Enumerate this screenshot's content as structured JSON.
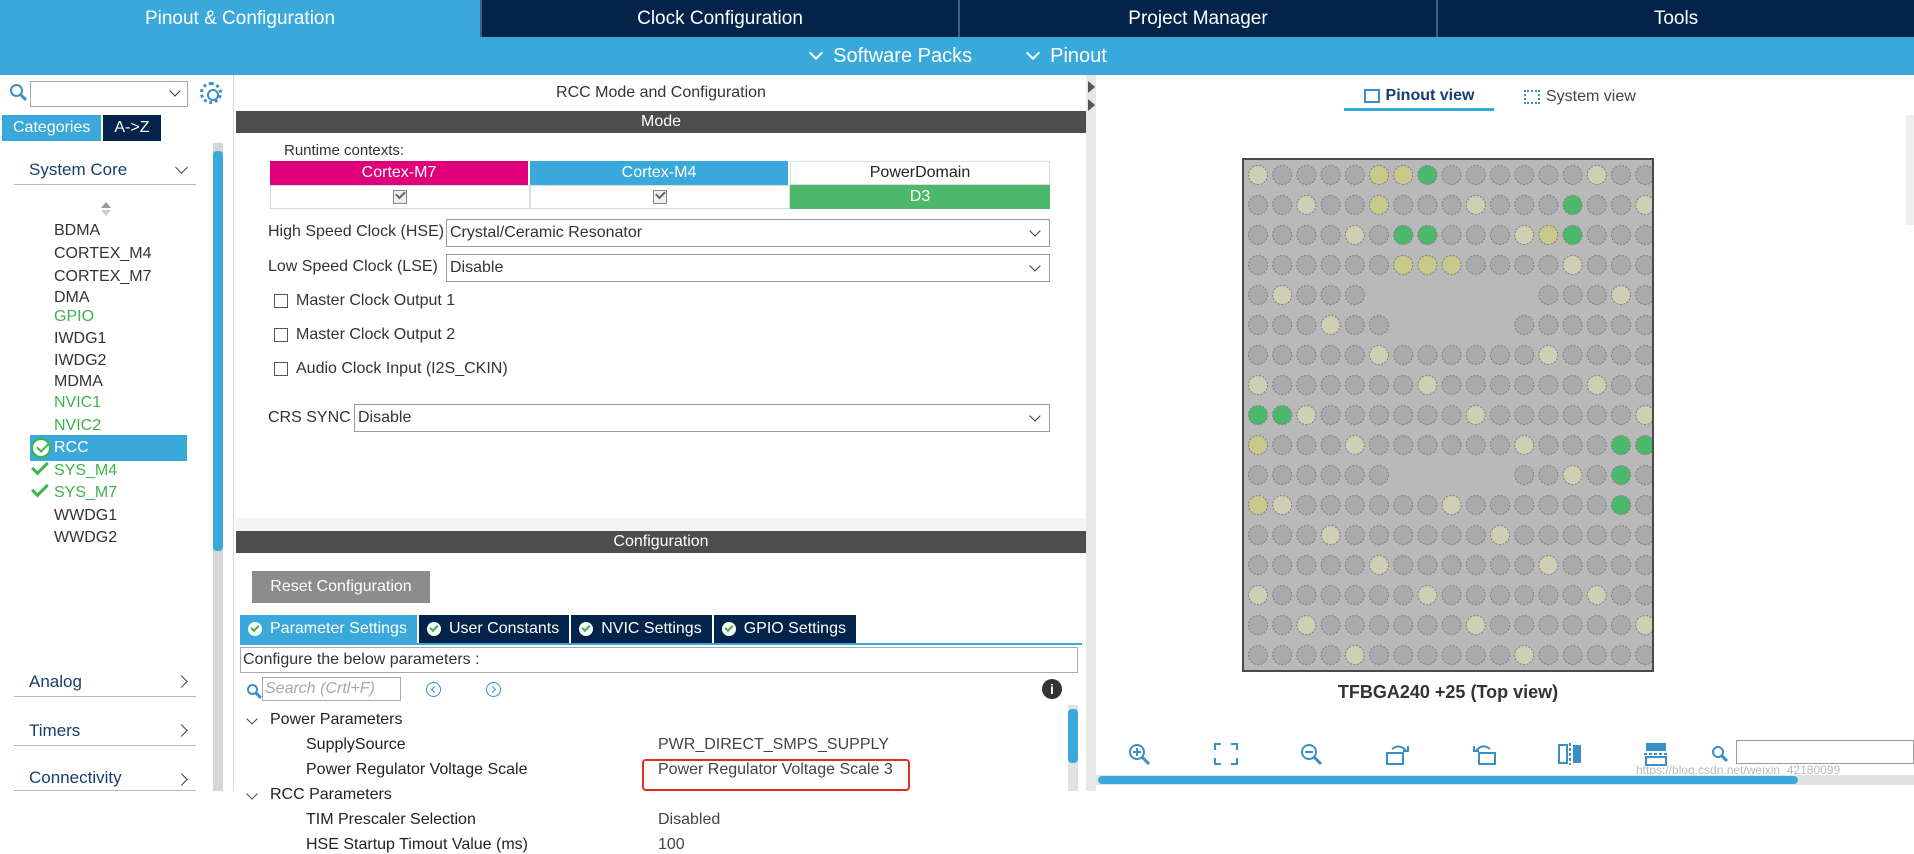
{
  "top_tabs": [
    {
      "label": "Pinout & Configuration",
      "active": true
    },
    {
      "label": "Clock Configuration",
      "active": false
    },
    {
      "label": "Project Manager",
      "active": false
    },
    {
      "label": "Tools",
      "active": false
    }
  ],
  "sub_menu": [
    {
      "label": "Software Packs"
    },
    {
      "label": "Pinout"
    }
  ],
  "sidebar": {
    "search_value": "",
    "category_tabs": [
      "Categories",
      "A->Z"
    ],
    "groups": {
      "system_core": "System Core",
      "analog": "Analog",
      "timers": "Timers",
      "connectivity": "Connectivity"
    },
    "peripherals": [
      {
        "label": "BDMA",
        "state": "normal"
      },
      {
        "label": "CORTEX_M4",
        "state": "normal"
      },
      {
        "label": "CORTEX_M7",
        "state": "normal"
      },
      {
        "label": "DMA",
        "state": "normal"
      },
      {
        "label": "GPIO",
        "state": "green"
      },
      {
        "label": "IWDG1",
        "state": "normal"
      },
      {
        "label": "IWDG2",
        "state": "normal"
      },
      {
        "label": "MDMA",
        "state": "normal"
      },
      {
        "label": "NVIC1",
        "state": "green"
      },
      {
        "label": "NVIC2",
        "state": "green"
      },
      {
        "label": "RCC",
        "state": "selected"
      },
      {
        "label": "SYS_M4",
        "state": "checked"
      },
      {
        "label": "SYS_M7",
        "state": "checked"
      },
      {
        "label": "WWDG1",
        "state": "normal"
      },
      {
        "label": "WWDG2",
        "state": "normal"
      }
    ]
  },
  "center": {
    "title": "RCC Mode and Configuration",
    "mode_header": "Mode",
    "runtime_label": "Runtime contexts:",
    "contexts": [
      {
        "label": "Cortex-M7",
        "color": "#e0007a",
        "value": "checked"
      },
      {
        "label": "Cortex-M4",
        "color": "#39a9dc",
        "value": "checked"
      },
      {
        "label": "PowerDomain",
        "color": "#ffffff",
        "value": "D3"
      }
    ],
    "powerdomain_value_color": "#4cb86b",
    "hse_label": "High Speed Clock (HSE)",
    "hse_value": "Crystal/Ceramic Resonator",
    "lse_label": "Low Speed Clock (LSE)",
    "lse_value": "Disable",
    "checkboxes": [
      "Master Clock Output 1",
      "Master Clock Output 2",
      "Audio Clock Input (I2S_CKIN)"
    ],
    "crs_label": "CRS SYNC",
    "crs_value": "Disable",
    "config_header": "Configuration",
    "reset_label": "Reset Configuration",
    "param_tabs": [
      "Parameter Settings",
      "User Constants",
      "NVIC Settings",
      "GPIO Settings"
    ],
    "configure_text": "Configure the below parameters :",
    "search_placeholder": "Search (Crtl+F)",
    "info_symbol": "i",
    "param_groups": {
      "power": "Power Parameters",
      "rcc": "RCC Parameters"
    },
    "params": [
      {
        "name": "SupplySource",
        "value": "PWR_DIRECT_SMPS_SUPPLY"
      },
      {
        "name": "Power Regulator Voltage Scale",
        "value": "Power Regulator Voltage Scale 3"
      },
      {
        "name": "TIM Prescaler Selection",
        "value": "Disabled"
      },
      {
        "name": "HSE Startup Timout Value (ms)",
        "value": "100"
      }
    ]
  },
  "right": {
    "view_tabs": [
      {
        "label": "Pinout view",
        "active": true
      },
      {
        "label": "System view",
        "active": false
      }
    ],
    "chip_label": "TFBGA240 +25 (Top view)",
    "tools": [
      "zoom-in-icon",
      "fit-icon",
      "zoom-out-icon",
      "rotate-right-icon",
      "rotate-left-icon",
      "flip-vertical-icon",
      "flip-horizontal-icon",
      "search-icon"
    ],
    "search_value": "",
    "watermark": "https://blog.csdn.net/weixin_42180099"
  }
}
